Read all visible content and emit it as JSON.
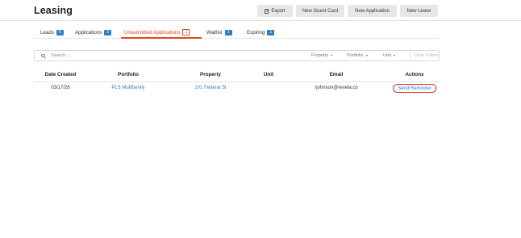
{
  "header": {
    "title": "Leasing",
    "buttons": {
      "export": "Export",
      "new_guest_card": "New Guest Card",
      "new_application": "New Application",
      "new_lease": "New Lease"
    }
  },
  "tabs": [
    {
      "label": "Leads",
      "count": "6"
    },
    {
      "label": "Applications",
      "count": "2"
    },
    {
      "label": "Unsubmitted Applications",
      "count": "1",
      "active": true
    },
    {
      "label": "Waitlist",
      "count": "1"
    },
    {
      "label": "Expiring",
      "count": "1"
    }
  ],
  "filters": {
    "search_placeholder": "Search...",
    "property": "Property",
    "portfolio": "Portfolio",
    "unit": "Unit",
    "clear": "Clear Filters"
  },
  "table": {
    "columns": [
      "Date Created",
      "Portfolio",
      "Property",
      "Unit",
      "Email",
      "Actions"
    ],
    "rows": [
      {
        "date_created": "03/17/26",
        "portfolio": "PLS Multifamily",
        "property": "101 Federal St",
        "unit": "",
        "email": "rjohnson@revela.co",
        "action": "Send Reminder"
      }
    ]
  },
  "colors": {
    "accent": "#e04a1f",
    "link": "#2d7fc4",
    "highlight_ring": "#e03020"
  }
}
